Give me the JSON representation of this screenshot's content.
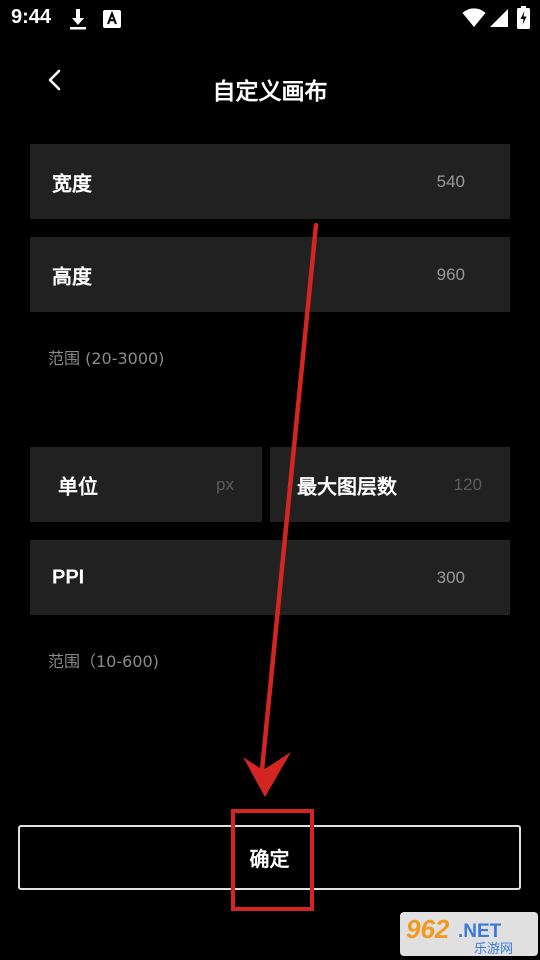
{
  "status_bar": {
    "time": "9:44",
    "icons": [
      "download-icon",
      "a-notification-icon",
      "wifi-icon",
      "signal-icon",
      "battery-charging-icon"
    ]
  },
  "header": {
    "back_icon": "chevron-left-icon",
    "title": "自定义画布"
  },
  "canvas": {
    "width_label": "宽度",
    "width_value": "540",
    "height_label": "高度",
    "height_value": "960",
    "size_range": "范围 (20-3000)"
  },
  "settings": {
    "unit_label": "单位",
    "unit_value": "px",
    "max_layers_label": "最大图层数",
    "max_layers_value": "120",
    "ppi_label": "PPI",
    "ppi_value": "300",
    "ppi_range": "范围（10-600)"
  },
  "confirm_label": "确定",
  "annotation": {
    "color": "#d32622"
  },
  "watermark": {
    "logo_text": "962.NET",
    "sub_text": "乐游网"
  }
}
